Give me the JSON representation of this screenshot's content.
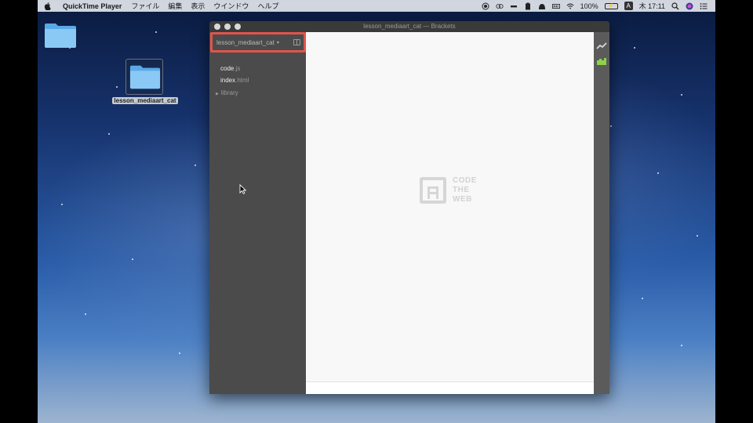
{
  "menubar": {
    "app_name": "QuickTime Player",
    "menus": [
      "ファイル",
      "編集",
      "表示",
      "ウインドウ",
      "ヘルプ"
    ],
    "battery_text": "100%",
    "input_source": "A",
    "clock": "木 17:11"
  },
  "desktop": {
    "selected_folder_label": "lesson_mediaart_cat"
  },
  "window": {
    "title": "lesson_mediaart_cat — Brackets"
  },
  "sidebar": {
    "project_name": "lesson_mediaart_cat",
    "project_caret": "▾",
    "files": [
      {
        "name": "code",
        "ext": ".js"
      },
      {
        "name": "index",
        "ext": ".html"
      }
    ],
    "folders": [
      {
        "name": "library"
      }
    ]
  },
  "editor": {
    "logo_words": [
      "CODE",
      "THE",
      "WEB"
    ]
  },
  "icons": {
    "live_preview": "live-preview-icon",
    "extension_manager": "extension-manager-icon"
  },
  "colors": {
    "highlight": "#e0544a",
    "extension_icon": "#8bd448"
  }
}
